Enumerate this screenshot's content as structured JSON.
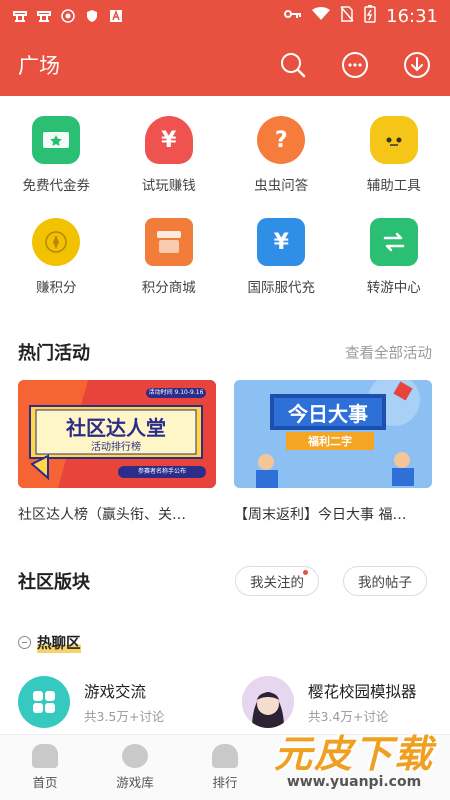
{
  "status_bar": {
    "time": "16:31"
  },
  "header": {
    "title": "广场"
  },
  "features": [
    {
      "label": "免费代金券",
      "icon": "ticket-icon",
      "color": "#2bbf73"
    },
    {
      "label": "试玩赚钱",
      "icon": "money-bag-icon",
      "color": "#ef5350"
    },
    {
      "label": "虫虫问答",
      "icon": "question-icon",
      "color": "#f57c3a"
    },
    {
      "label": "辅助工具",
      "icon": "robot-icon",
      "color": "#f5c518"
    },
    {
      "label": "赚积分",
      "icon": "coin-icon",
      "color": "#f2c200"
    },
    {
      "label": "积分商城",
      "icon": "shop-icon",
      "color": "#f27c3a"
    },
    {
      "label": "国际服代充",
      "icon": "wallet-icon",
      "color": "#2f8ee6"
    },
    {
      "label": "转游中心",
      "icon": "transfer-icon",
      "color": "#2bbf73"
    }
  ],
  "hot_activities": {
    "title": "热门活动",
    "view_all": "查看全部活动",
    "banners": [
      {
        "image_text": "社区达人堂",
        "sub_text": "活动排行榜",
        "date_text": "活动时间 9.10-9.16",
        "bottom_text": "参赛者名称手公布",
        "caption": "社区达人榜（赢头衔、关…"
      },
      {
        "image_text": "今日大事",
        "sub_text": "福利二字",
        "caption": "【周末返利】今日大事 福…"
      }
    ]
  },
  "community": {
    "title": "社区版块",
    "followed_label": "我关注的",
    "my_posts_label": "我的帖子",
    "hot_section_label": "热聊区",
    "forums": [
      {
        "name": "游戏交流",
        "stats": "共3.5万+讨论"
      },
      {
        "name": "樱花校园模拟器",
        "stats": "共3.4万+讨论"
      }
    ]
  },
  "bottom_nav": [
    {
      "label": "首页"
    },
    {
      "label": "游戏库"
    },
    {
      "label": "排行"
    }
  ],
  "watermark": {
    "title": "元皮下载",
    "url": "www.yuanpi.com"
  }
}
